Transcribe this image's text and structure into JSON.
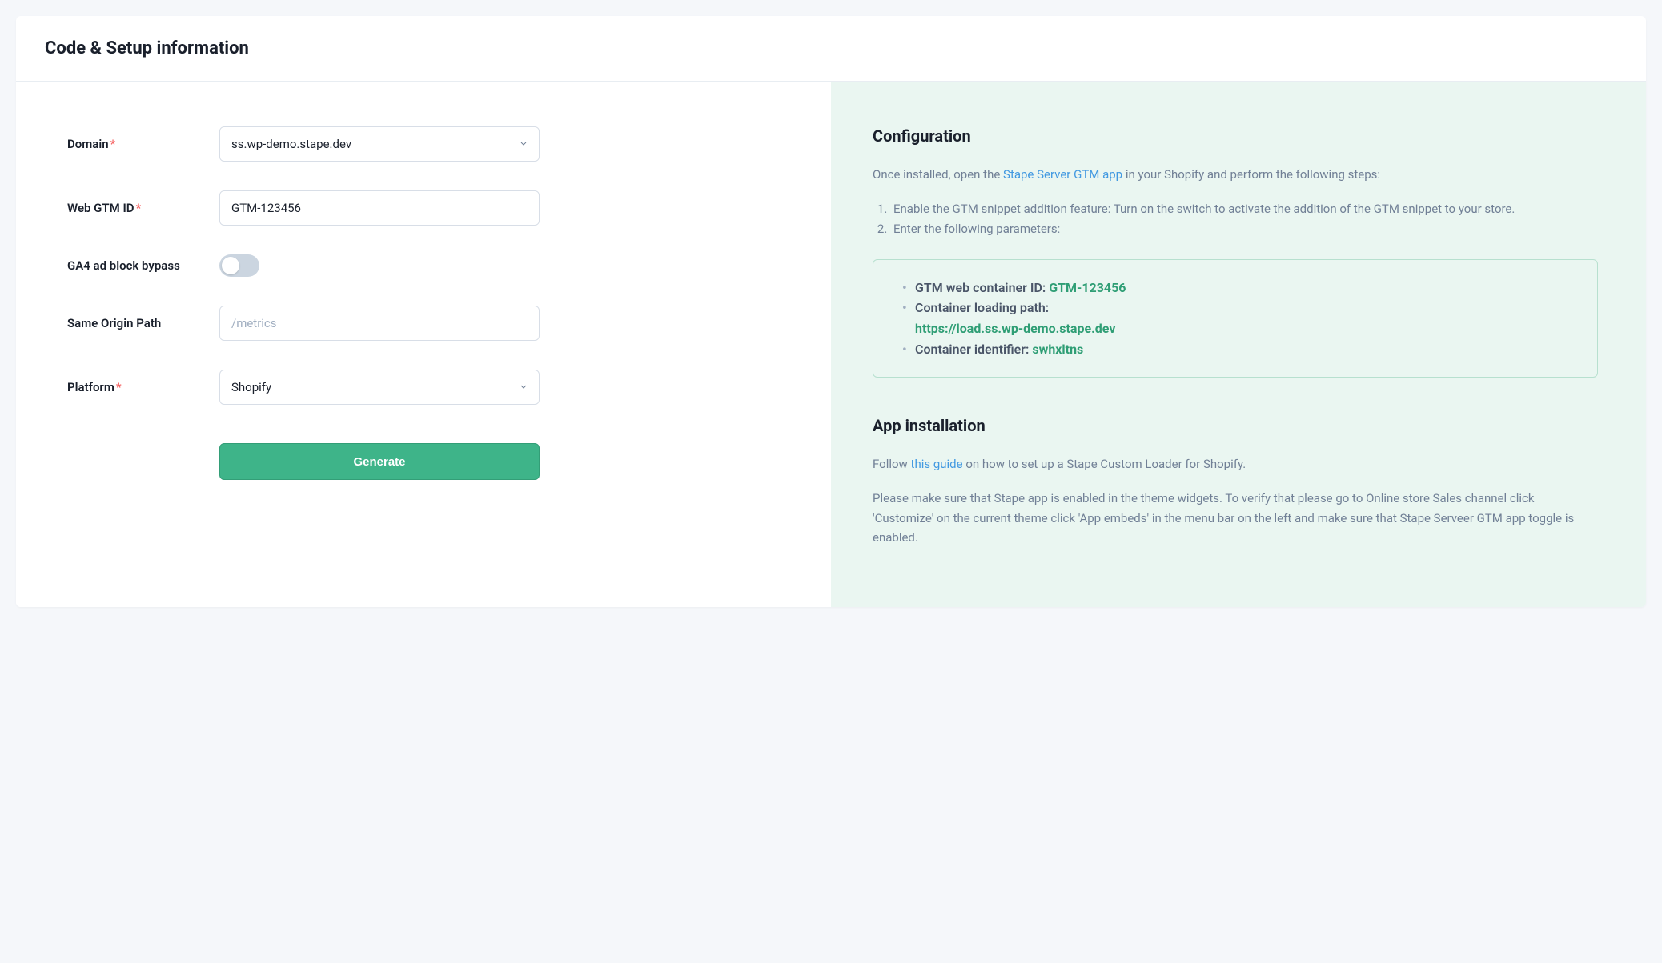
{
  "header": {
    "title": "Code & Setup information"
  },
  "form": {
    "domain": {
      "label": "Domain",
      "value": "ss.wp-demo.stape.dev"
    },
    "gtm": {
      "label": "Web GTM ID",
      "value": "GTM-123456"
    },
    "ga4": {
      "label": "GA4 ad block bypass"
    },
    "sop": {
      "label": "Same Origin Path",
      "placeholder": "/metrics"
    },
    "platform": {
      "label": "Platform",
      "value": "Shopify"
    },
    "generate": "Generate"
  },
  "config": {
    "title": "Configuration",
    "intro_before": "Once installed, open the ",
    "intro_link": "Stape Server GTM app",
    "intro_after": " in your Shopify and perform the following steps:",
    "step1": "Enable the GTM snippet addition feature: Turn on the switch to activate the addition of the GTM snippet to your store.",
    "step2": "Enter the following parameters:",
    "params": {
      "gtm_label": "GTM web container ID: ",
      "gtm_value": "GTM-123456",
      "path_label": "Container loading path:",
      "path_value": "https://load.ss.wp-demo.stape.dev",
      "id_label": "Container identifier: ",
      "id_value": "swhxltns"
    }
  },
  "install": {
    "title": "App installation",
    "follow_before": "Follow ",
    "follow_link": "this guide",
    "follow_after": " on how to set up a Stape Custom Loader for Shopify.",
    "note": "Please make sure that Stape app is enabled in the theme widgets. To verify that please go to Online store Sales channel click 'Customize' on the current theme click 'App embeds' in the menu bar on the left and make sure that Stape Serveer GTM app toggle is enabled."
  }
}
